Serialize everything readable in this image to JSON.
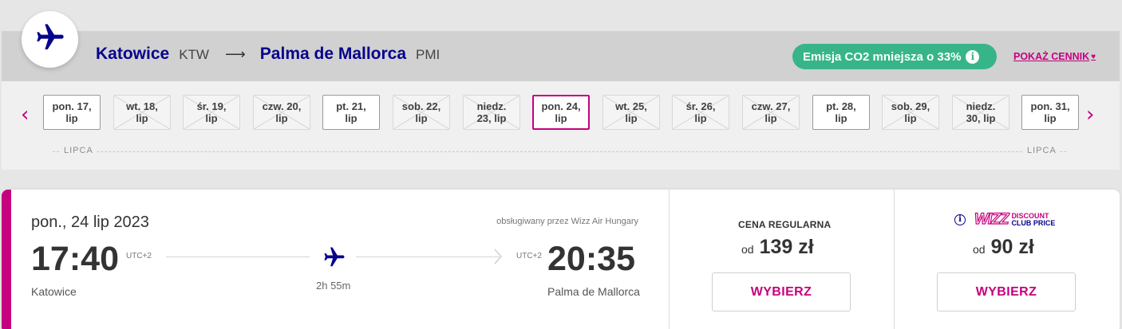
{
  "route": {
    "origin_city": "Katowice",
    "origin_code": "KTW",
    "destination_city": "Palma de Mallorca",
    "destination_code": "PMI",
    "arrow": "⟶",
    "co2_badge": "Emisja CO2 mniejsza o 33%",
    "show_prices_link": "POKAŻ CENNIK"
  },
  "date_strip": {
    "month_left": "LIPCA",
    "month_right": "LIPCA",
    "days": [
      {
        "line1": "pon. 17,",
        "line2": "lip",
        "state": "avail"
      },
      {
        "line1": "wt. 18,",
        "line2": "lip",
        "state": "dis"
      },
      {
        "line1": "śr. 19,",
        "line2": "lip",
        "state": "dis"
      },
      {
        "line1": "czw. 20,",
        "line2": "lip",
        "state": "dis"
      },
      {
        "line1": "pt. 21,",
        "line2": "lip",
        "state": "avail"
      },
      {
        "line1": "sob. 22,",
        "line2": "lip",
        "state": "dis"
      },
      {
        "line1": "niedz.",
        "line2": "23, lip",
        "state": "dis"
      },
      {
        "line1": "pon. 24,",
        "line2": "lip",
        "state": "sel"
      },
      {
        "line1": "wt. 25,",
        "line2": "lip",
        "state": "dis"
      },
      {
        "line1": "śr. 26,",
        "line2": "lip",
        "state": "dis"
      },
      {
        "line1": "czw. 27,",
        "line2": "lip",
        "state": "dis"
      },
      {
        "line1": "pt. 28,",
        "line2": "lip",
        "state": "avail"
      },
      {
        "line1": "sob. 29,",
        "line2": "lip",
        "state": "dis"
      },
      {
        "line1": "niedz.",
        "line2": "30, lip",
        "state": "dis"
      },
      {
        "line1": "pon. 31,",
        "line2": "lip",
        "state": "avail"
      }
    ]
  },
  "flight": {
    "date": "pon., 24 lip 2023",
    "operator": "obsługiwany przez Wizz Air Hungary",
    "departure_time": "17:40",
    "departure_tz": "UTC+2",
    "departure_place": "Katowice",
    "arrival_time": "20:35",
    "arrival_tz": "UTC+2",
    "arrival_place": "Palma de Mallorca",
    "duration": "2h 55m"
  },
  "fares": {
    "regular": {
      "title": "CENA REGULARNA",
      "from": "od",
      "price": "139 zł",
      "button": "WYBIERZ"
    },
    "discount": {
      "logo_wizz": "WIZZ",
      "logo_line1": "DISCOUNT",
      "logo_line2": "CLUB PRICE",
      "info_icon": "i",
      "from": "od",
      "price": "90 zł",
      "button": "WYBIERZ"
    }
  },
  "colors": {
    "brand_blue": "#06038d",
    "brand_magenta": "#c6007e",
    "co2_green": "#37b589"
  }
}
